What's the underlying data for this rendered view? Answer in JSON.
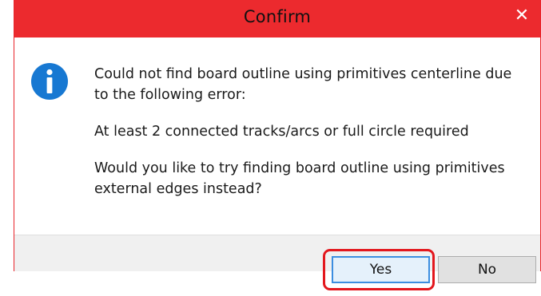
{
  "window": {
    "title": "Confirm",
    "close_glyph": "✕",
    "titlebar_color": "#ec2a2e"
  },
  "icon": {
    "name": "info-icon",
    "color": "#1778d2",
    "glyph": "i"
  },
  "message": {
    "line1": "Could not find board outline using primitives centerline due to the following error:",
    "line2": "At least 2 connected tracks/arcs or full circle required",
    "line3": "Would you like to try finding board outline using primitives external edges instead?"
  },
  "buttons": {
    "yes_label": "Yes",
    "no_label": "No"
  },
  "annotation": {
    "highlight_color": "#e3171d",
    "highlight_target": "yes-button"
  }
}
